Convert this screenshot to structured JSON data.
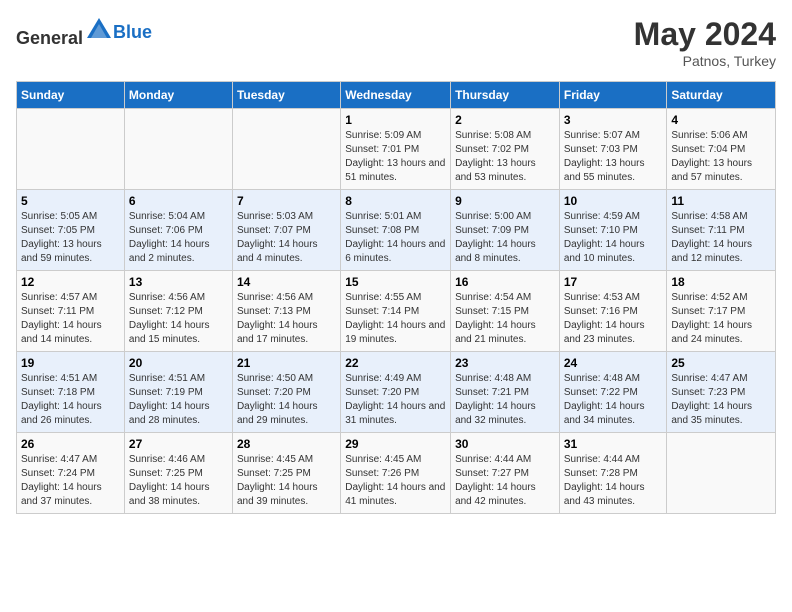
{
  "header": {
    "logo_general": "General",
    "logo_blue": "Blue",
    "title": "May 2024",
    "subtitle": "Patnos, Turkey"
  },
  "weekdays": [
    "Sunday",
    "Monday",
    "Tuesday",
    "Wednesday",
    "Thursday",
    "Friday",
    "Saturday"
  ],
  "weeks": [
    [
      {
        "day": "",
        "sunrise": "",
        "sunset": "",
        "daylight": ""
      },
      {
        "day": "",
        "sunrise": "",
        "sunset": "",
        "daylight": ""
      },
      {
        "day": "",
        "sunrise": "",
        "sunset": "",
        "daylight": ""
      },
      {
        "day": "1",
        "sunrise": "Sunrise: 5:09 AM",
        "sunset": "Sunset: 7:01 PM",
        "daylight": "Daylight: 13 hours and 51 minutes."
      },
      {
        "day": "2",
        "sunrise": "Sunrise: 5:08 AM",
        "sunset": "Sunset: 7:02 PM",
        "daylight": "Daylight: 13 hours and 53 minutes."
      },
      {
        "day": "3",
        "sunrise": "Sunrise: 5:07 AM",
        "sunset": "Sunset: 7:03 PM",
        "daylight": "Daylight: 13 hours and 55 minutes."
      },
      {
        "day": "4",
        "sunrise": "Sunrise: 5:06 AM",
        "sunset": "Sunset: 7:04 PM",
        "daylight": "Daylight: 13 hours and 57 minutes."
      }
    ],
    [
      {
        "day": "5",
        "sunrise": "Sunrise: 5:05 AM",
        "sunset": "Sunset: 7:05 PM",
        "daylight": "Daylight: 13 hours and 59 minutes."
      },
      {
        "day": "6",
        "sunrise": "Sunrise: 5:04 AM",
        "sunset": "Sunset: 7:06 PM",
        "daylight": "Daylight: 14 hours and 2 minutes."
      },
      {
        "day": "7",
        "sunrise": "Sunrise: 5:03 AM",
        "sunset": "Sunset: 7:07 PM",
        "daylight": "Daylight: 14 hours and 4 minutes."
      },
      {
        "day": "8",
        "sunrise": "Sunrise: 5:01 AM",
        "sunset": "Sunset: 7:08 PM",
        "daylight": "Daylight: 14 hours and 6 minutes."
      },
      {
        "day": "9",
        "sunrise": "Sunrise: 5:00 AM",
        "sunset": "Sunset: 7:09 PM",
        "daylight": "Daylight: 14 hours and 8 minutes."
      },
      {
        "day": "10",
        "sunrise": "Sunrise: 4:59 AM",
        "sunset": "Sunset: 7:10 PM",
        "daylight": "Daylight: 14 hours and 10 minutes."
      },
      {
        "day": "11",
        "sunrise": "Sunrise: 4:58 AM",
        "sunset": "Sunset: 7:11 PM",
        "daylight": "Daylight: 14 hours and 12 minutes."
      }
    ],
    [
      {
        "day": "12",
        "sunrise": "Sunrise: 4:57 AM",
        "sunset": "Sunset: 7:11 PM",
        "daylight": "Daylight: 14 hours and 14 minutes."
      },
      {
        "day": "13",
        "sunrise": "Sunrise: 4:56 AM",
        "sunset": "Sunset: 7:12 PM",
        "daylight": "Daylight: 14 hours and 15 minutes."
      },
      {
        "day": "14",
        "sunrise": "Sunrise: 4:56 AM",
        "sunset": "Sunset: 7:13 PM",
        "daylight": "Daylight: 14 hours and 17 minutes."
      },
      {
        "day": "15",
        "sunrise": "Sunrise: 4:55 AM",
        "sunset": "Sunset: 7:14 PM",
        "daylight": "Daylight: 14 hours and 19 minutes."
      },
      {
        "day": "16",
        "sunrise": "Sunrise: 4:54 AM",
        "sunset": "Sunset: 7:15 PM",
        "daylight": "Daylight: 14 hours and 21 minutes."
      },
      {
        "day": "17",
        "sunrise": "Sunrise: 4:53 AM",
        "sunset": "Sunset: 7:16 PM",
        "daylight": "Daylight: 14 hours and 23 minutes."
      },
      {
        "day": "18",
        "sunrise": "Sunrise: 4:52 AM",
        "sunset": "Sunset: 7:17 PM",
        "daylight": "Daylight: 14 hours and 24 minutes."
      }
    ],
    [
      {
        "day": "19",
        "sunrise": "Sunrise: 4:51 AM",
        "sunset": "Sunset: 7:18 PM",
        "daylight": "Daylight: 14 hours and 26 minutes."
      },
      {
        "day": "20",
        "sunrise": "Sunrise: 4:51 AM",
        "sunset": "Sunset: 7:19 PM",
        "daylight": "Daylight: 14 hours and 28 minutes."
      },
      {
        "day": "21",
        "sunrise": "Sunrise: 4:50 AM",
        "sunset": "Sunset: 7:20 PM",
        "daylight": "Daylight: 14 hours and 29 minutes."
      },
      {
        "day": "22",
        "sunrise": "Sunrise: 4:49 AM",
        "sunset": "Sunset: 7:20 PM",
        "daylight": "Daylight: 14 hours and 31 minutes."
      },
      {
        "day": "23",
        "sunrise": "Sunrise: 4:48 AM",
        "sunset": "Sunset: 7:21 PM",
        "daylight": "Daylight: 14 hours and 32 minutes."
      },
      {
        "day": "24",
        "sunrise": "Sunrise: 4:48 AM",
        "sunset": "Sunset: 7:22 PM",
        "daylight": "Daylight: 14 hours and 34 minutes."
      },
      {
        "day": "25",
        "sunrise": "Sunrise: 4:47 AM",
        "sunset": "Sunset: 7:23 PM",
        "daylight": "Daylight: 14 hours and 35 minutes."
      }
    ],
    [
      {
        "day": "26",
        "sunrise": "Sunrise: 4:47 AM",
        "sunset": "Sunset: 7:24 PM",
        "daylight": "Daylight: 14 hours and 37 minutes."
      },
      {
        "day": "27",
        "sunrise": "Sunrise: 4:46 AM",
        "sunset": "Sunset: 7:25 PM",
        "daylight": "Daylight: 14 hours and 38 minutes."
      },
      {
        "day": "28",
        "sunrise": "Sunrise: 4:45 AM",
        "sunset": "Sunset: 7:25 PM",
        "daylight": "Daylight: 14 hours and 39 minutes."
      },
      {
        "day": "29",
        "sunrise": "Sunrise: 4:45 AM",
        "sunset": "Sunset: 7:26 PM",
        "daylight": "Daylight: 14 hours and 41 minutes."
      },
      {
        "day": "30",
        "sunrise": "Sunrise: 4:44 AM",
        "sunset": "Sunset: 7:27 PM",
        "daylight": "Daylight: 14 hours and 42 minutes."
      },
      {
        "day": "31",
        "sunrise": "Sunrise: 4:44 AM",
        "sunset": "Sunset: 7:28 PM",
        "daylight": "Daylight: 14 hours and 43 minutes."
      },
      {
        "day": "",
        "sunrise": "",
        "sunset": "",
        "daylight": ""
      }
    ]
  ]
}
